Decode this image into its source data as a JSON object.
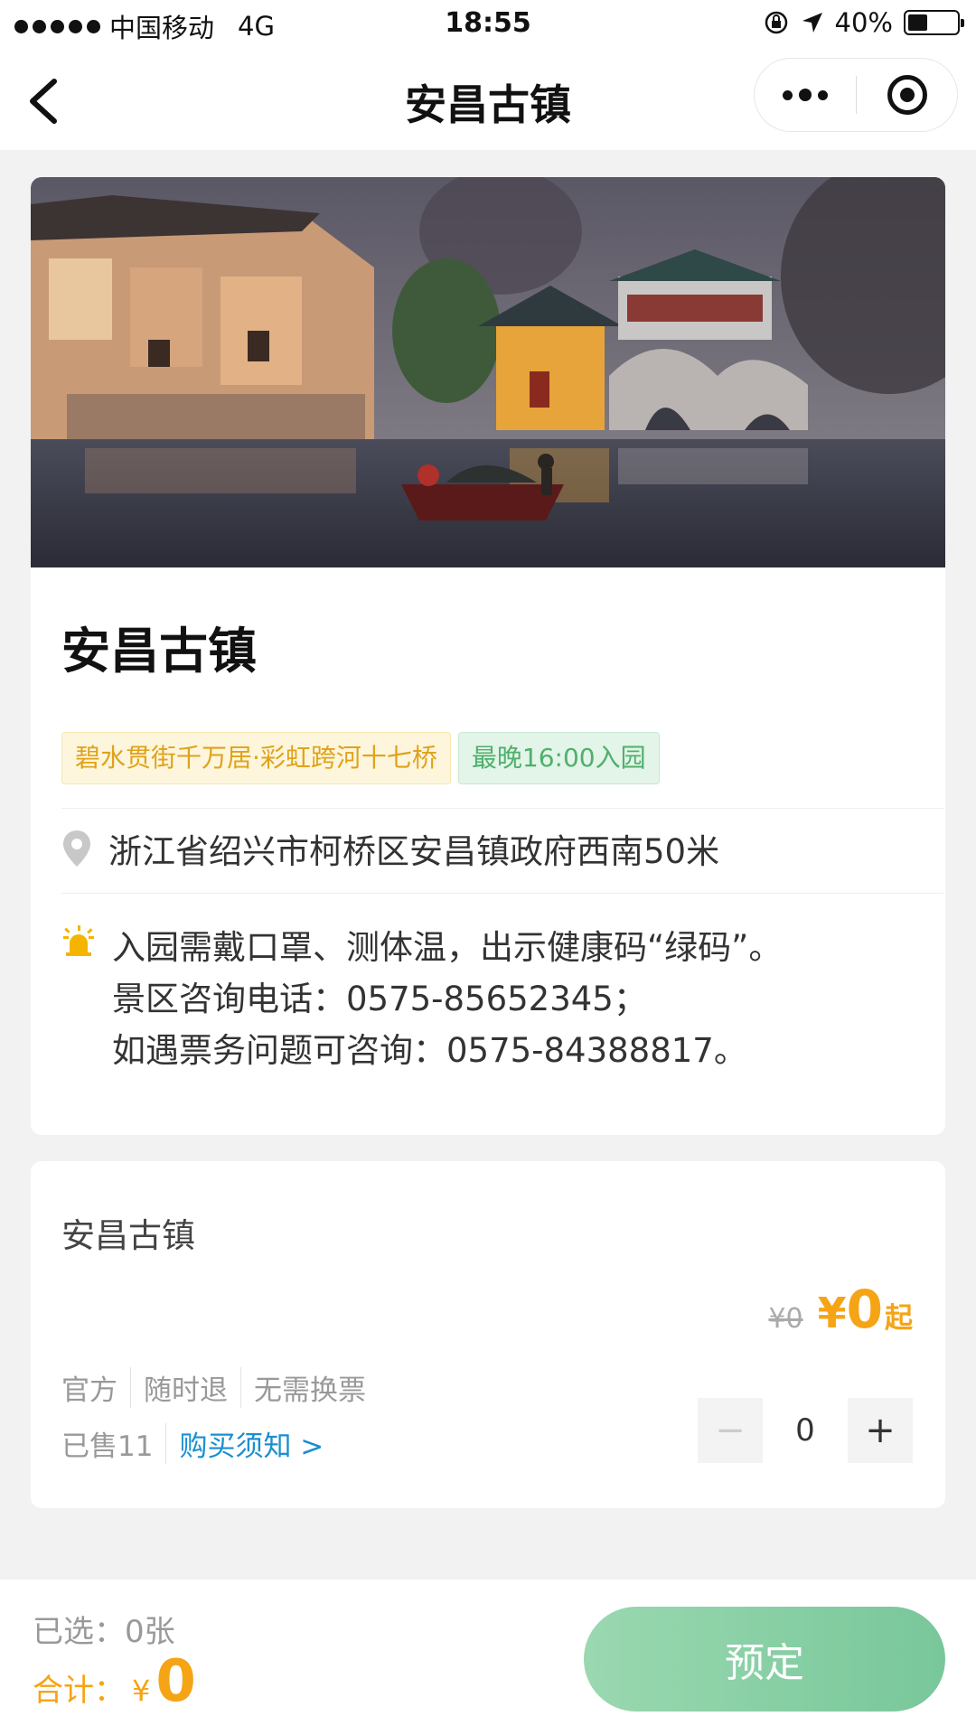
{
  "status_bar": {
    "carrier": "中国移动",
    "network": "4G",
    "time": "18:55",
    "battery": "40%",
    "battery_level": 0.4
  },
  "nav": {
    "title": "安昌古镇"
  },
  "spot": {
    "title": "安昌古镇",
    "tags": [
      "碧水贯街千万居·彩虹跨河十七桥",
      "最晚16:00入园"
    ],
    "address": "浙江省绍兴市柯桥区安昌镇政府西南50米",
    "notice": [
      "入园需戴口罩、测体温，出示健康码“绿码”。",
      "景区咨询电话：0575-85652345；",
      "如遇票务问题可咨询：0575-84388817。"
    ]
  },
  "ticket": {
    "name": "安昌古镇",
    "original_price": "¥0",
    "currency": "¥",
    "price": "0",
    "price_suffix": "起",
    "features": [
      "官方",
      "随时退",
      "无需换票"
    ],
    "sold": "已售11",
    "purchase_notice": "购买须知 >",
    "quantity": "0",
    "minus": "−",
    "plus": "+"
  },
  "bottom": {
    "selected": "已选：0张",
    "total_label": "合计：",
    "total_currency": "¥",
    "total_value": "0",
    "book_button": "预定"
  },
  "colors": {
    "accent_orange": "#f5a416",
    "accent_green": "#78c79a",
    "link_blue": "#1a8fd0"
  },
  "icons": {
    "back": "chevron-left-icon",
    "more": "more-dots-icon",
    "close": "target-icon",
    "location": "location-pin-icon",
    "notice": "alarm-light-icon"
  }
}
